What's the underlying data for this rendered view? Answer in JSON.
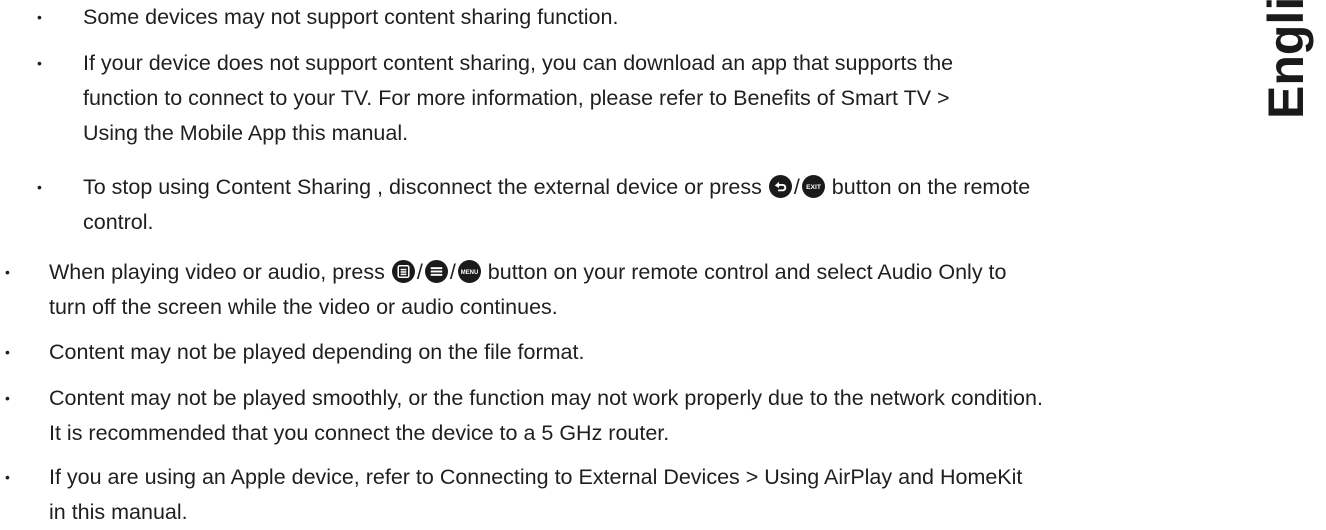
{
  "side_tab": {
    "label": "English"
  },
  "sub_bullets": [
    {
      "lines": [
        "Some devices may not support content sharing function."
      ]
    },
    {
      "lines": [
        "If your device does not support content sharing, you can download an app that supports the",
        "function to connect to your TV. For more information, please refer to Benefits of Smart TV >",
        "Using the Mobile App this manual."
      ]
    },
    {
      "line1_before": "To stop using Content Sharing  , disconnect the external device or press",
      "line1_after": "button on the remote",
      "line2": "control.",
      "icons": [
        "back-icon",
        "exit-icon"
      ],
      "exit_icon_label": "EXIT"
    }
  ],
  "main_bullets": [
    {
      "line1_before": "When playing video or audio, press",
      "line1_after": "button on your remote control and select Audio Only to",
      "line2": "turn off the screen while the video or audio continues.",
      "icons": [
        "options-icon",
        "menu-lines-icon",
        "menu-button-icon"
      ],
      "menu_icon_label": "MENU"
    },
    {
      "lines": [
        "Content may not be played depending on the file format."
      ]
    },
    {
      "lines": [
        "Content may not be played smoothly, or the function may not work properly due to the network condition.",
        "It is recommended that you connect the device to a 5 GHz router."
      ]
    },
    {
      "lines": [
        "If you are using an Apple device, refer to Connecting to External Devices > Using AirPlay and HomeKit",
        "in this manual."
      ]
    }
  ],
  "bullet_char": "•",
  "separator": "/"
}
